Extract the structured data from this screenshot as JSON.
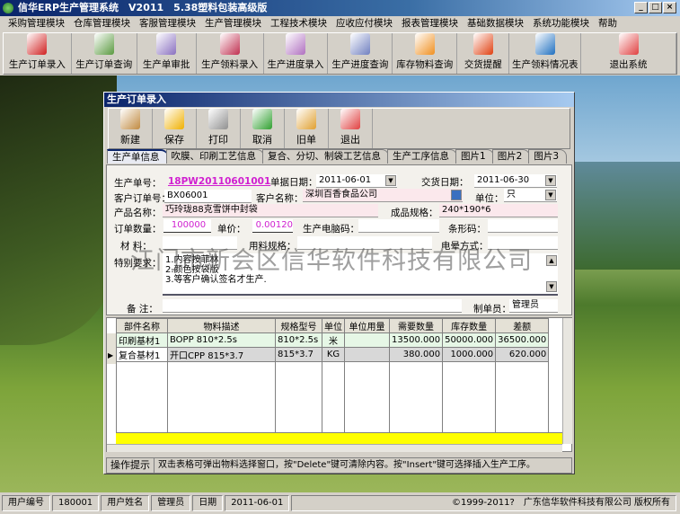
{
  "app": {
    "title": "信华ERP生产管理系统　V2011　5.38塑料包装高级版"
  },
  "menu": [
    "采购管理模块",
    "仓库管理模块",
    "客服管理模块",
    "生产管理模块",
    "工程技术模块",
    "应收应付模块",
    "报表管理模块",
    "基础数据模块",
    "系统功能模块",
    "帮助"
  ],
  "toolbar": [
    {
      "label": "生产订单录入",
      "icon": "pdf-icon",
      "color": "#d02020"
    },
    {
      "label": "生产订单查询",
      "icon": "document-icon",
      "color": "#5a9a40"
    },
    {
      "label": "生产单审批",
      "icon": "document-icon",
      "color": "#8a70c0"
    },
    {
      "label": "生产领料录入",
      "icon": "document-icon",
      "color": "#c03050"
    },
    {
      "label": "生产进度录入",
      "icon": "document-icon",
      "color": "#b070c0"
    },
    {
      "label": "生产进度查询",
      "icon": "document-icon",
      "color": "#7080c0"
    },
    {
      "label": "库存物料查询",
      "icon": "flower-icon",
      "color": "#f09020"
    },
    {
      "label": "交货提醒",
      "icon": "feather-icon",
      "color": "#e04010"
    },
    {
      "label": "生产领料情况表",
      "icon": "feather-icon",
      "color": "#2070c0"
    },
    {
      "label": "退出系统",
      "icon": "power-icon",
      "color": "#e04040"
    }
  ],
  "child": {
    "title": "生产订单录入",
    "buttons": [
      {
        "label": "新建",
        "icon": "clipboard-icon",
        "color": "#c08a40"
      },
      {
        "label": "保存",
        "icon": "save-icon",
        "color": "#f0b000"
      },
      {
        "label": "打印",
        "icon": "printer-icon",
        "color": "#909090"
      },
      {
        "label": "取消",
        "icon": "refresh-icon",
        "color": "#30a030"
      },
      {
        "label": "旧单",
        "icon": "folder-icon",
        "color": "#e0a030"
      },
      {
        "label": "退出",
        "icon": "power-icon",
        "color": "#e04040"
      }
    ],
    "tabs": [
      "生产单信息",
      "吹膜、印刷工艺信息",
      "复合、分切、制袋工艺信息",
      "生产工序信息",
      "图片1",
      "图片2",
      "图片3"
    ]
  },
  "form": {
    "order_no_label": "生产单号：",
    "order_no": "18PW20110601001",
    "doc_date_label": "单据日期：",
    "doc_date": "2011-06-01",
    "delivery_label": "交货日期：",
    "delivery": "2011-06-30",
    "cust_order_label": "客户订单号：",
    "cust_order": "BX06001",
    "cust_name_label": "客户名称：",
    "cust_name": "深圳百香食品公司",
    "unit_label": "单位：",
    "unit": "只",
    "product_label": "产品名称：",
    "product": "巧玲珑88克雪饼中封袋",
    "spec_label": "成品规格：",
    "spec": "240*190*6",
    "qty_label": "订单数量：",
    "qty": "100000",
    "price_label": "单价：",
    "price": "0.00120",
    "pcode_label": "生产电脑码：",
    "pcode": "",
    "barcode_label": "条形码：",
    "barcode": "",
    "material_label": "材 料：",
    "material": "",
    "mat_spec_label": "用料规格：",
    "mat_spec": "",
    "power_label": "电晕方式：",
    "power": "",
    "special_label": "特别要求：",
    "special": [
      "1.内容按菲林",
      "2.颜色按袋版",
      "3.等客户确认签名才生产."
    ],
    "remark_label": "备 注：",
    "remark": "",
    "maker_label": "制单员：",
    "maker": "管理员"
  },
  "grid": {
    "columns": [
      "部件名称",
      "物料描述",
      "规格型号",
      "单位",
      "单位用量",
      "需要数量",
      "库存数量",
      "差额"
    ],
    "rows": [
      [
        "印刷基材1",
        "BOPP 810*2.5s",
        "810*2.5s",
        "米",
        "",
        "13500.000",
        "50000.000",
        "36500.000"
      ],
      [
        "复合基材1",
        "开口CPP 815*3.7",
        "815*3.7",
        "KG",
        "",
        "380.000",
        "1000.000",
        "620.000"
      ]
    ]
  },
  "hint": {
    "label": "操作提示",
    "text": "双击表格可弹出物料选择窗口，按\"Delete\"键可清除内容。按\"Insert\"键可选择插入生产工序。"
  },
  "status": [
    "用户编号",
    "180001",
    "用户姓名",
    "管理员",
    "日期",
    "2011-06-01",
    "©1999-2011?　广东信华软件科技有限公司 版权所有"
  ],
  "watermark": "江门市新会区信华软件科技有限公司"
}
